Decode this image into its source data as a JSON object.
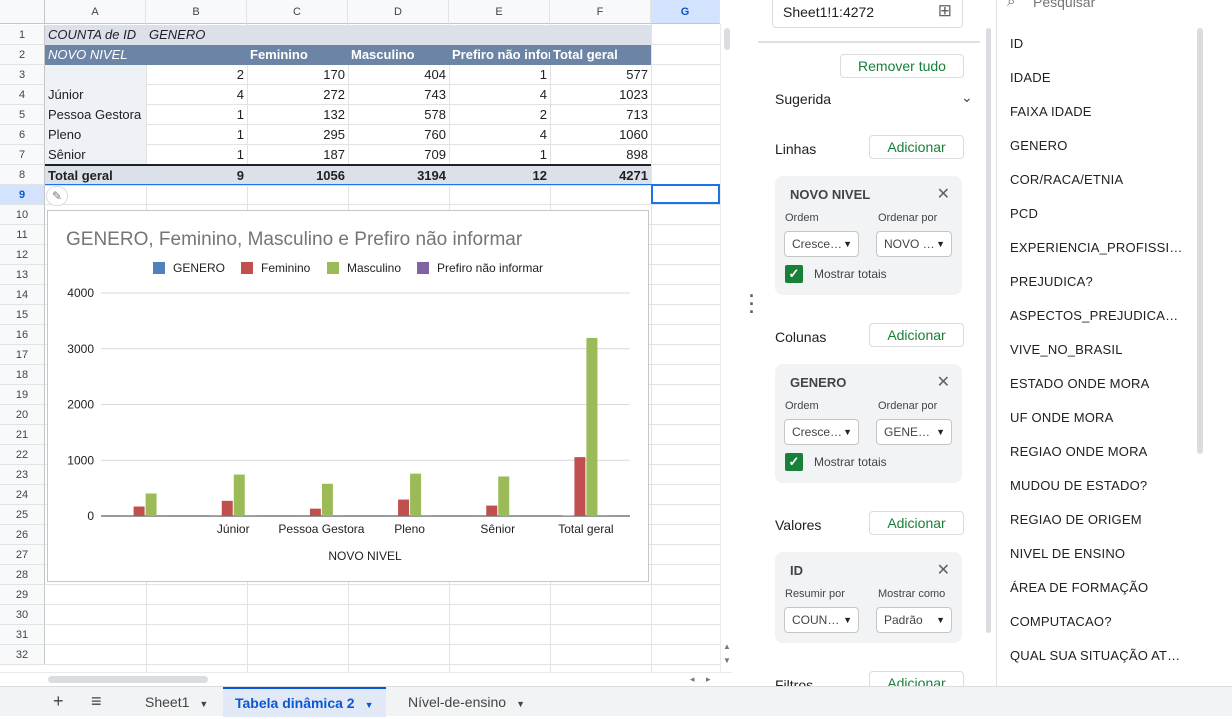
{
  "grid": {
    "columns": [
      "A",
      "B",
      "C",
      "D",
      "E",
      "F",
      "G"
    ],
    "selected_column": "G",
    "selected_row": "9",
    "rows": [
      "1",
      "2",
      "3",
      "4",
      "5",
      "6",
      "7",
      "8",
      "9",
      "10",
      "11",
      "12",
      "13",
      "14",
      "15",
      "16",
      "17",
      "18",
      "19",
      "20",
      "21",
      "22",
      "23",
      "24",
      "25",
      "26",
      "27",
      "28",
      "29",
      "30",
      "31",
      "32"
    ]
  },
  "pivot": {
    "corner_label": "COUNTA de ID",
    "column_field": "GENERO",
    "row_field": "NOVO NIVEL",
    "headers": [
      "Feminino",
      "Masculino",
      "Prefiro não infon",
      "Total geral"
    ],
    "rows": [
      {
        "label": "",
        "values": [
          "2",
          "170",
          "404",
          "1",
          "577"
        ]
      },
      {
        "label": "Júnior",
        "values": [
          "4",
          "272",
          "743",
          "4",
          "1023"
        ]
      },
      {
        "label": "Pessoa Gestora",
        "values": [
          "1",
          "132",
          "578",
          "2",
          "713"
        ]
      },
      {
        "label": "Pleno",
        "values": [
          "1",
          "295",
          "760",
          "4",
          "1060"
        ]
      },
      {
        "label": "Sênior",
        "values": [
          "1",
          "187",
          "709",
          "1",
          "898"
        ]
      }
    ],
    "total": {
      "label": "Total geral",
      "values": [
        "9",
        "1056",
        "3194",
        "12",
        "4271"
      ]
    }
  },
  "chart_data": {
    "type": "bar",
    "title": "GENERO, Feminino, Masculino e Prefiro não informar",
    "xlabel": "NOVO NIVEL",
    "ylabel": "",
    "categories": [
      "",
      "Júnior",
      "Pessoa Gestora",
      "Pleno",
      "Sênior",
      "Total geral"
    ],
    "series": [
      {
        "name": "GENERO",
        "color": "#4f81bd",
        "values": [
          2,
          4,
          1,
          1,
          1,
          9
        ]
      },
      {
        "name": "Feminino",
        "color": "#c0504d",
        "values": [
          170,
          272,
          132,
          295,
          187,
          1056
        ]
      },
      {
        "name": "Masculino",
        "color": "#9bbb59",
        "values": [
          404,
          743,
          578,
          760,
          709,
          3194
        ]
      },
      {
        "name": "Prefiro não informar",
        "color": "#8064a2",
        "values": [
          1,
          4,
          2,
          4,
          1,
          12
        ]
      }
    ],
    "yticks": [
      0,
      1000,
      2000,
      3000,
      4000
    ],
    "ylim": [
      0,
      4000
    ],
    "grid": true,
    "legend_position": "top"
  },
  "editor": {
    "range": "Sheet1!1:4272",
    "remove_all": "Remover tudo",
    "suggested": "Sugerida",
    "add_label": "Adicionar",
    "rows_label": "Linhas",
    "columns_label": "Colunas",
    "values_label": "Valores",
    "filters_label": "Filtros",
    "rows_card": {
      "title": "NOVO NIVEL",
      "order_label": "Ordem",
      "sort_by_label": "Ordenar por",
      "order": "Cresce…",
      "sort_by": "NOVO …",
      "show_totals": "Mostrar totais"
    },
    "cols_card": {
      "title": "GENERO",
      "order_label": "Ordem",
      "sort_by_label": "Ordenar por",
      "order": "Cresce…",
      "sort_by": "GENE…",
      "show_totals": "Mostrar totais"
    },
    "values_card": {
      "title": "ID",
      "summarize_label": "Resumir por",
      "show_as_label": "Mostrar como",
      "summarize": "COUN…",
      "show_as": "Padrão"
    }
  },
  "fields": {
    "search_placeholder": "Pesquisar",
    "items": [
      "ID",
      "IDADE",
      "FAIXA IDADE",
      "GENERO",
      "COR/RACA/ETNIA",
      "PCD",
      "EXPERIENCIA_PROFISSI…",
      "PREJUDICA?",
      "ASPECTOS_PREJUDICA…",
      "VIVE_NO_BRASIL",
      "ESTADO ONDE MORA",
      "UF ONDE MORA",
      "REGIAO ONDE MORA",
      "MUDOU DE ESTADO?",
      "REGIAO DE ORIGEM",
      "NIVEL DE ENSINO",
      "ÁREA DE FORMAÇÃO",
      "COMPUTACAO?",
      "QUAL SUA SITUAÇÃO AT…"
    ]
  },
  "tabs": {
    "add": "+",
    "menu": "≡",
    "items": [
      "Sheet1",
      "Tabela dinâmica 2",
      "Nível-de-ensino"
    ],
    "active_index": 1
  }
}
